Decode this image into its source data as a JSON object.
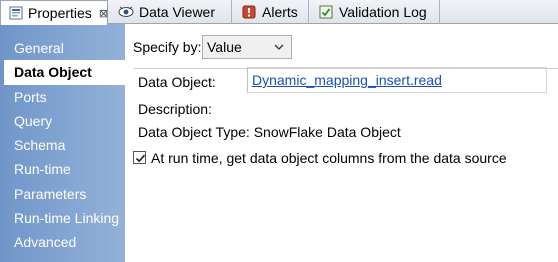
{
  "tabs": [
    {
      "label": "Properties",
      "icon": "properties-icon",
      "active": true
    },
    {
      "label": "Data Viewer",
      "icon": "data-viewer-icon"
    },
    {
      "label": "Alerts",
      "icon": "alerts-icon"
    },
    {
      "label": "Validation Log",
      "icon": "validation-log-icon"
    }
  ],
  "tab_close_glyph": "⊠",
  "sidebar": {
    "items": [
      {
        "label": "General"
      },
      {
        "label": "Data Object",
        "selected": true
      },
      {
        "label": "Ports"
      },
      {
        "label": "Query"
      },
      {
        "label": "Schema"
      },
      {
        "label": "Run-time"
      },
      {
        "label": "Parameters"
      },
      {
        "label": "Run-time Linking"
      },
      {
        "label": "Advanced"
      }
    ]
  },
  "form": {
    "specify_by_label": "Specify by:",
    "specify_by_value": "Value",
    "data_object_label": "Data Object:",
    "data_object_value": "Dynamic_mapping_insert.read",
    "description_label": "Description:",
    "data_object_type_label": "Data Object Type:",
    "data_object_type_value": "SnowFlake Data Object",
    "runtime_checkbox_label": "At run time, get data object columns from the data source",
    "runtime_checkbox_checked": true
  },
  "colors": {
    "sidebar_accent": "#7a9dcc",
    "link": "#1a4fb8"
  }
}
